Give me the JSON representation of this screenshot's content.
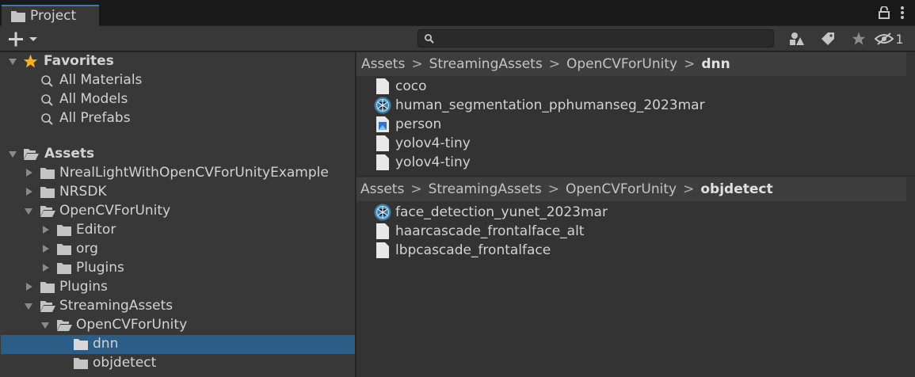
{
  "tab": {
    "label": "Project"
  },
  "toolbar": {
    "search_value": "",
    "hidden_count": "1"
  },
  "tree": {
    "favorites_label": "Favorites",
    "favorites": [
      "All Materials",
      "All Models",
      "All Prefabs"
    ],
    "assets_label": "Assets",
    "items": [
      {
        "label": "NrealLightWithOpenCVForUnityExample"
      },
      {
        "label": "NRSDK"
      },
      {
        "label": "OpenCVForUnity"
      },
      {
        "label": "Editor"
      },
      {
        "label": "org"
      },
      {
        "label": "Plugins"
      },
      {
        "label": "Plugins"
      },
      {
        "label": "StreamingAssets"
      },
      {
        "label": "OpenCVForUnity"
      },
      {
        "label": "dnn"
      },
      {
        "label": "objdetect"
      }
    ]
  },
  "sections": [
    {
      "breadcrumb": [
        "Assets",
        "StreamingAssets",
        "OpenCVForUnity",
        "dnn"
      ],
      "files": [
        {
          "name": "coco",
          "icon": "text-file-icon"
        },
        {
          "name": "human_segmentation_pphumanseg_2023mar",
          "icon": "onnx-model-icon"
        },
        {
          "name": "person",
          "icon": "image-file-icon"
        },
        {
          "name": "yolov4-tiny",
          "icon": "text-file-icon"
        },
        {
          "name": "yolov4-tiny",
          "icon": "text-file-icon"
        }
      ]
    },
    {
      "breadcrumb": [
        "Assets",
        "StreamingAssets",
        "OpenCVForUnity",
        "objdetect"
      ],
      "files": [
        {
          "name": "face_detection_yunet_2023mar",
          "icon": "onnx-model-icon"
        },
        {
          "name": "haarcascade_frontalface_alt",
          "icon": "text-file-icon"
        },
        {
          "name": "lbpcascade_frontalface",
          "icon": "text-file-icon"
        }
      ]
    }
  ],
  "colors": {
    "selection": "#2c5d87",
    "tab_accent": "#3a79bb",
    "star": "#f5b41d"
  }
}
